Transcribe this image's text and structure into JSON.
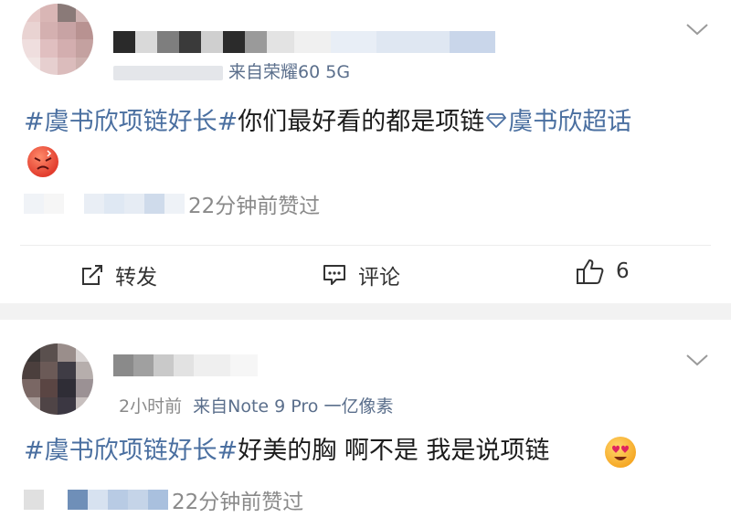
{
  "posts": [
    {
      "meta_source": "来自荣耀60 5G",
      "hashtag": "#虞书欣项链好长#",
      "body": "你们最好看的都是项链",
      "topic_link": "虞书欣超话",
      "liked_text": "22分钟前赞过",
      "actions": {
        "repost": "转发",
        "comment": "评论",
        "like_count": "6"
      }
    },
    {
      "meta_time": "2小时前",
      "meta_source": "来自Note 9 Pro 一亿像素",
      "hashtag": "#虞书欣项链好长#",
      "body": "好美的胸 啊不是 我是说项链",
      "liked_text": "22分钟前赞过"
    }
  ],
  "colors": {
    "link": "#4a6fa0",
    "meta": "#8a8a8a",
    "separator": "#f2f2f2"
  }
}
